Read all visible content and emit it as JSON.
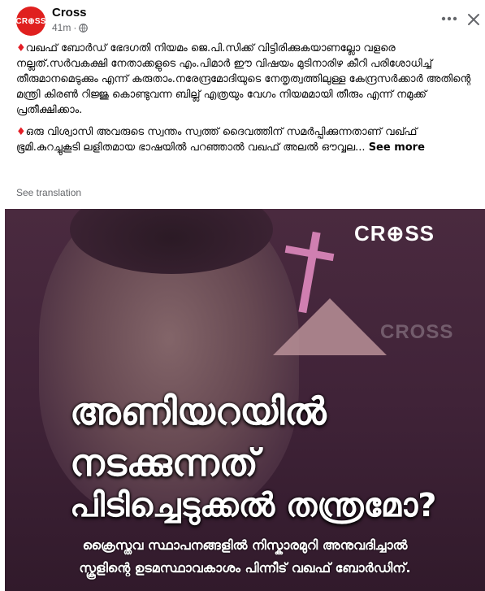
{
  "header": {
    "avatar_text": "CR⊕SS",
    "author": "Cross",
    "time": "41m",
    "separator": "·",
    "privacy_icon": "globe-icon",
    "more_icon": "more-horizontal-icon",
    "close_icon": "close-icon"
  },
  "post": {
    "bullet": "♦",
    "paragraph1": "വഖഫ് ബോർഡ് ഭേദഗതി നിയമം ജെ.പി.സിക്ക് വിട്ടിരിക്കുകയാണല്ലോ വളരെ നല്ലത്.സർവകക്ഷി നേതാക്കളുടെ എം.പിമാർ ഈ വിഷയം മുടിനാരിഴ കീറി പരിശോധിച്ച്  തീരുമാനമെടുക്കും എന്ന് കരുതാം.നരേന്ദ്രമോദിയുടെ നേതൃത്വത്തിലുള്ള കേന്ദ്രസർക്കാർ അതിന്റെ മന്ത്രി കിരൺ റിജ്ജു കൊണ്ടുവന്ന ബില്ല് എത്രയും വേഗം നിയമമായി തീരും എന്ന് നമുക്ക് പ്രതീക്ഷിക്കാം.",
    "paragraph2": "ഒരു വിശ്വാസി അവരുടെ സ്വന്തം സ്വത്ത് ദൈവത്തിന് സമർപ്പിക്കുന്നതാണ് വഖ്ഫ് ഭൂമി.കുറച്ചുകൂടി ലളിതമായ ഭാഷയിൽ പറഞ്ഞാൽ വഖഫ് അലൽ ഔവ്വല...",
    "see_more": "See more",
    "see_translation": "See translation"
  },
  "image": {
    "logo": "CR⊕SS",
    "watermark": "CROSS",
    "headline_line1": "അണിയറയിൽ",
    "headline_line2": "നടക്കുന്നത്",
    "headline_line3": "പിടിച്ചെടുക്കൽ തന്ത്രമോ?",
    "subline1": "ക്രൈസ്തവ സ്ഥാപനങ്ങളിൽ  നിസ്കാരമുറി അനുവദിച്ചാൽ",
    "subline2": "സ്കൂളിന്റെ ഉടമസ്ഥാവകാശം പിന്നീട് വഖഫ് ബോർഡിന്."
  },
  "colors": {
    "brand": "#e0201f",
    "bullet": "#e41e26",
    "secondary_text": "#65676b",
    "image_bg": "#3f2336",
    "cross": "#d07fb1"
  }
}
